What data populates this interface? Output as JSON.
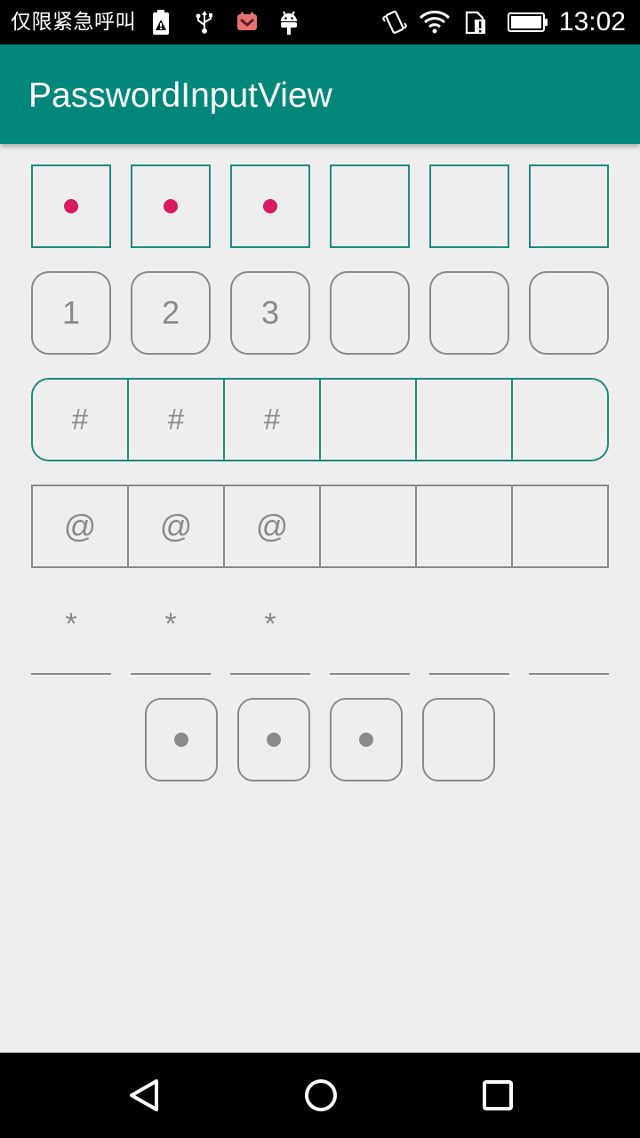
{
  "status_bar": {
    "carrier_text": "仅限紧急呼叫",
    "time": "13:02",
    "icons": [
      "battery-warning-icon",
      "usb-icon",
      "notification-icon",
      "android-debug-icon",
      "vibrate-icon",
      "wifi-icon",
      "sim-alert-icon",
      "battery-icon"
    ]
  },
  "app_bar": {
    "title": "PasswordInputView"
  },
  "rows": {
    "square_dots": {
      "filled": 3,
      "total": 6,
      "dot_color": "#d81b60",
      "border_color": "#1f8a80"
    },
    "rounded_plain": {
      "values": [
        "1",
        "2",
        "3",
        "",
        "",
        ""
      ]
    },
    "joined_rounded": {
      "values": [
        "#",
        "#",
        "#",
        "",
        "",
        ""
      ],
      "border_color": "#1f8a80"
    },
    "joined_square": {
      "values": [
        "@",
        "@",
        "@",
        "",
        "",
        ""
      ]
    },
    "underline": {
      "values": [
        "*",
        "*",
        "*",
        "",
        "",
        ""
      ]
    },
    "rounded_dots": {
      "filled": 3,
      "total": 4,
      "dot_color": "#8a8a8a"
    }
  },
  "nav_bar": {
    "icons": [
      "back-icon",
      "home-icon",
      "recents-icon"
    ]
  },
  "colors": {
    "primary": "#00877a",
    "background": "#eeeeee",
    "text_gray": "#8a8a8a"
  }
}
